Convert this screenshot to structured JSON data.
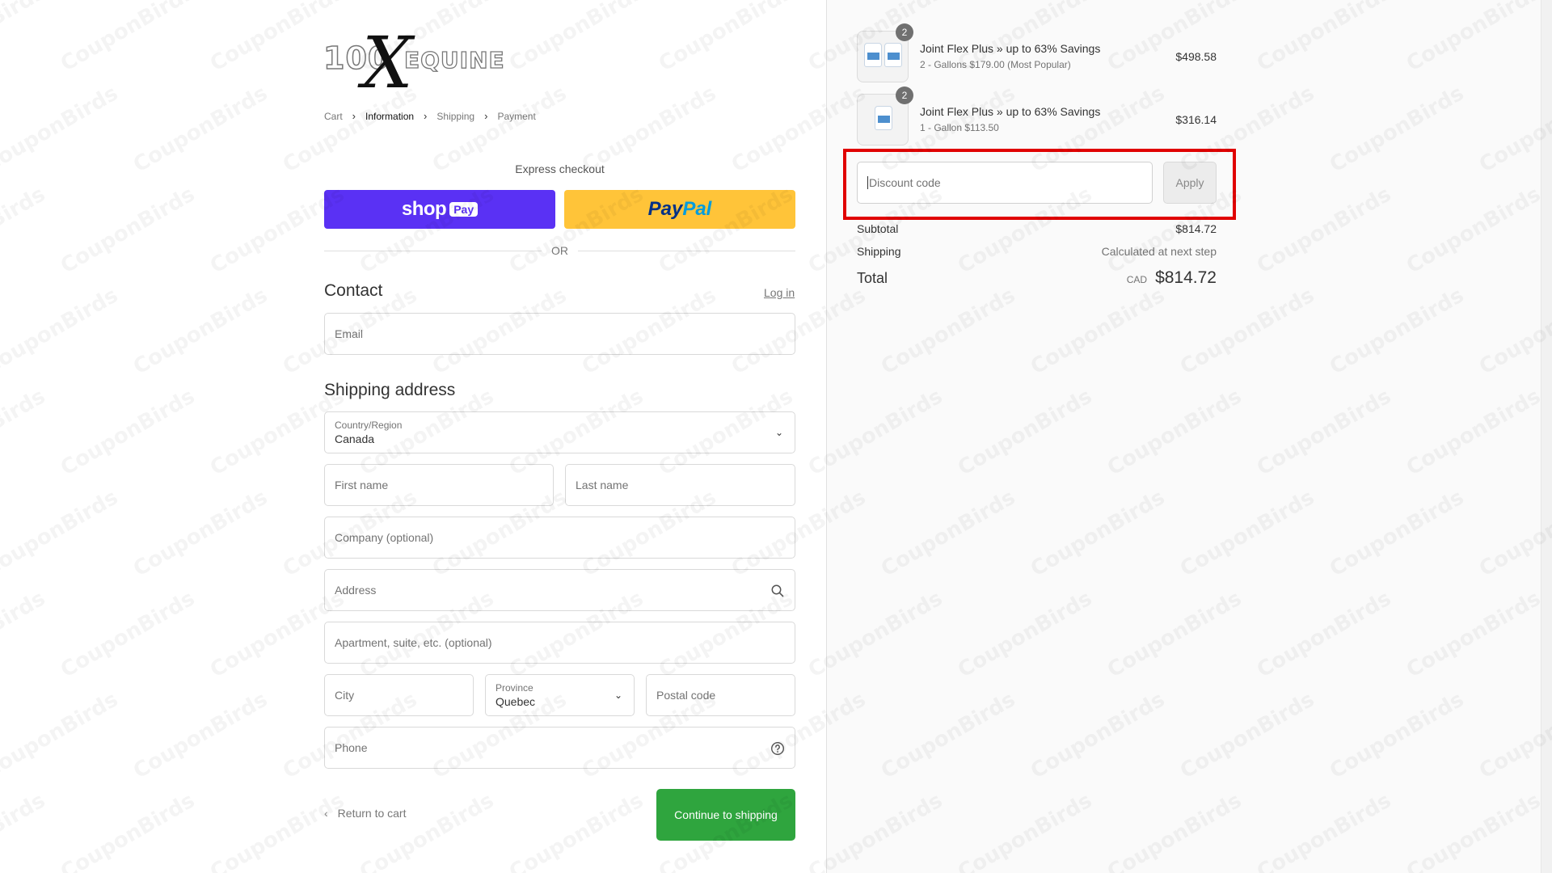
{
  "logo": {
    "num": "100",
    "x": "X",
    "name": "EQUINE"
  },
  "breadcrumb": {
    "items": [
      {
        "label": "Cart"
      },
      {
        "label": "Information"
      },
      {
        "label": "Shipping"
      },
      {
        "label": "Payment"
      }
    ],
    "active": "Information"
  },
  "express": {
    "title": "Express checkout",
    "shop_word": "shop",
    "shop_pay": "Pay",
    "paypal_part1": "Pay",
    "paypal_part2": "Pal",
    "or": "OR"
  },
  "contact": {
    "heading": "Contact",
    "login": "Log in",
    "email_placeholder": "Email"
  },
  "shipping_address": {
    "heading": "Shipping address",
    "country_label": "Country/Region",
    "country_value": "Canada",
    "first_name": "First name",
    "last_name": "Last name",
    "company": "Company (optional)",
    "address": "Address",
    "apartment": "Apartment, suite, etc. (optional)",
    "city": "City",
    "province_label": "Province",
    "province_value": "Quebec",
    "postal": "Postal code",
    "phone": "Phone"
  },
  "footer_actions": {
    "return": "Return to cart",
    "continue": "Continue to shipping"
  },
  "order": {
    "items": [
      {
        "title": "Joint Flex Plus » up to 63% Savings",
        "variant": "2 - Gallons $179.00 (Most Popular)",
        "price": "$498.58",
        "qty": "2"
      },
      {
        "title": "Joint Flex Plus » up to 63% Savings",
        "variant": "1 - Gallon $113.50",
        "price": "$316.14",
        "qty": "2"
      }
    ],
    "discount_placeholder": "Discount code",
    "apply": "Apply",
    "subtotal_label": "Subtotal",
    "subtotal": "$814.72",
    "shipping_label": "Shipping",
    "shipping_value": "Calculated at next step",
    "total_label": "Total",
    "currency": "CAD",
    "total": "$814.72"
  },
  "watermark": "CouponBirds",
  "colors": {
    "shop_pay": "#5a31f4",
    "paypal": "#ffc439",
    "continue": "#2fa53e",
    "highlight": "#e00000"
  }
}
